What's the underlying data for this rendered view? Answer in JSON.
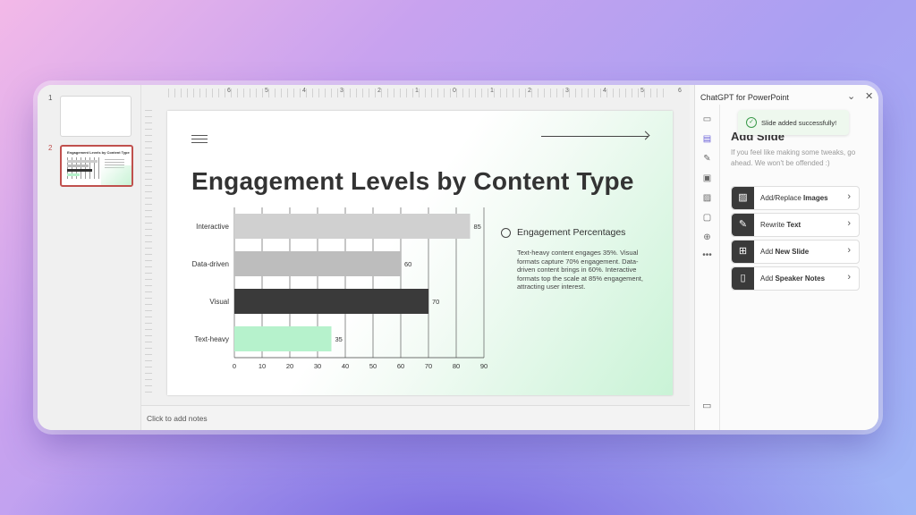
{
  "thumbnails": [
    {
      "number": "1"
    },
    {
      "number": "2",
      "title": "Engagement Levels by Content Type"
    }
  ],
  "ruler": [
    "6",
    "5",
    "4",
    "3",
    "2",
    "1",
    "0",
    "1",
    "2",
    "3",
    "4",
    "5",
    "6"
  ],
  "slide": {
    "title": "Engagement Levels by Content Type",
    "legend_title": "Engagement Percentages",
    "legend_text": "Text-heavy content engages 35%. Visual formats capture 70% engagement. Data-driven content brings in 60%. Interactive formats top the scale at 85% engagement, attracting user interest."
  },
  "chart_data": {
    "type": "bar",
    "orientation": "horizontal",
    "categories": [
      "Interactive",
      "Data-driven",
      "Visual",
      "Text-heavy"
    ],
    "values": [
      85,
      60,
      70,
      35
    ],
    "colors": [
      "#d0d0d0",
      "#bdbdbd",
      "#3a3a3a",
      "#b6f2cc"
    ],
    "xlim": [
      0,
      90
    ],
    "xticks": [
      0,
      10,
      20,
      30,
      40,
      50,
      60,
      70,
      80,
      90
    ],
    "grid": true
  },
  "notes": {
    "placeholder": "Click to add notes"
  },
  "panel": {
    "title": "ChatGPT for PowerPoint",
    "toast": "Slide added successfully!",
    "section_title": "Add Slide",
    "hint": "If you feel like making some tweaks, go ahead. We won't be offended :)",
    "actions": [
      {
        "prefix": "Add/Replace ",
        "bold": "Images",
        "icon": "image-icon"
      },
      {
        "prefix": "Rewrite ",
        "bold": "Text",
        "icon": "pencil-icon"
      },
      {
        "prefix": "Add ",
        "bold": "New Slide",
        "icon": "add-slide-icon"
      },
      {
        "prefix": "Add ",
        "bold": "Speaker Notes",
        "icon": "clipboard-icon"
      }
    ]
  }
}
